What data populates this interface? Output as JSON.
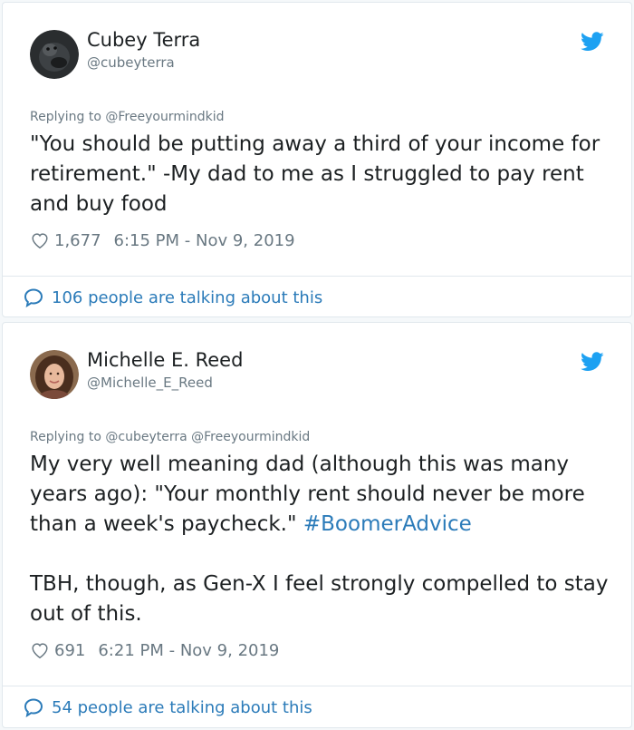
{
  "tweets": [
    {
      "name": "Cubey Terra",
      "handle": "@cubeyterra",
      "avatar_icon": "dark-animal-avatar",
      "replying_to": "Replying to @Freeyourmindkid",
      "text_paragraphs": [
        "\"You should be putting away a third of your income for retirement.\" -My dad to me as I struggled to pay rent and buy food"
      ],
      "likes": "1,677",
      "timestamp": "6:15 PM - Nov 9, 2019",
      "talking": "106 people are talking about this"
    },
    {
      "name": "Michelle E. Reed",
      "handle": "@Michelle_E_Reed",
      "avatar_icon": "woman-portrait-avatar",
      "replying_to": "Replying to @cubeyterra @Freeyourmindkid",
      "text_main": "My very well meaning dad (although this was many years ago): \"Your monthly rent should never be more than a week's paycheck.\" ",
      "hashtag": "#BoomerAdvice",
      "text_paragraph2": "TBH, though, as Gen-X I feel strongly compelled to stay out of this.",
      "likes": "691",
      "timestamp": "6:21 PM - Nov 9, 2019",
      "talking": "54 people are talking about this"
    }
  ],
  "colors": {
    "link": "#2b7bb9",
    "twitter_blue": "#1da1f2",
    "muted": "#697882",
    "text": "#1c2022",
    "border": "#e1e8ed"
  }
}
